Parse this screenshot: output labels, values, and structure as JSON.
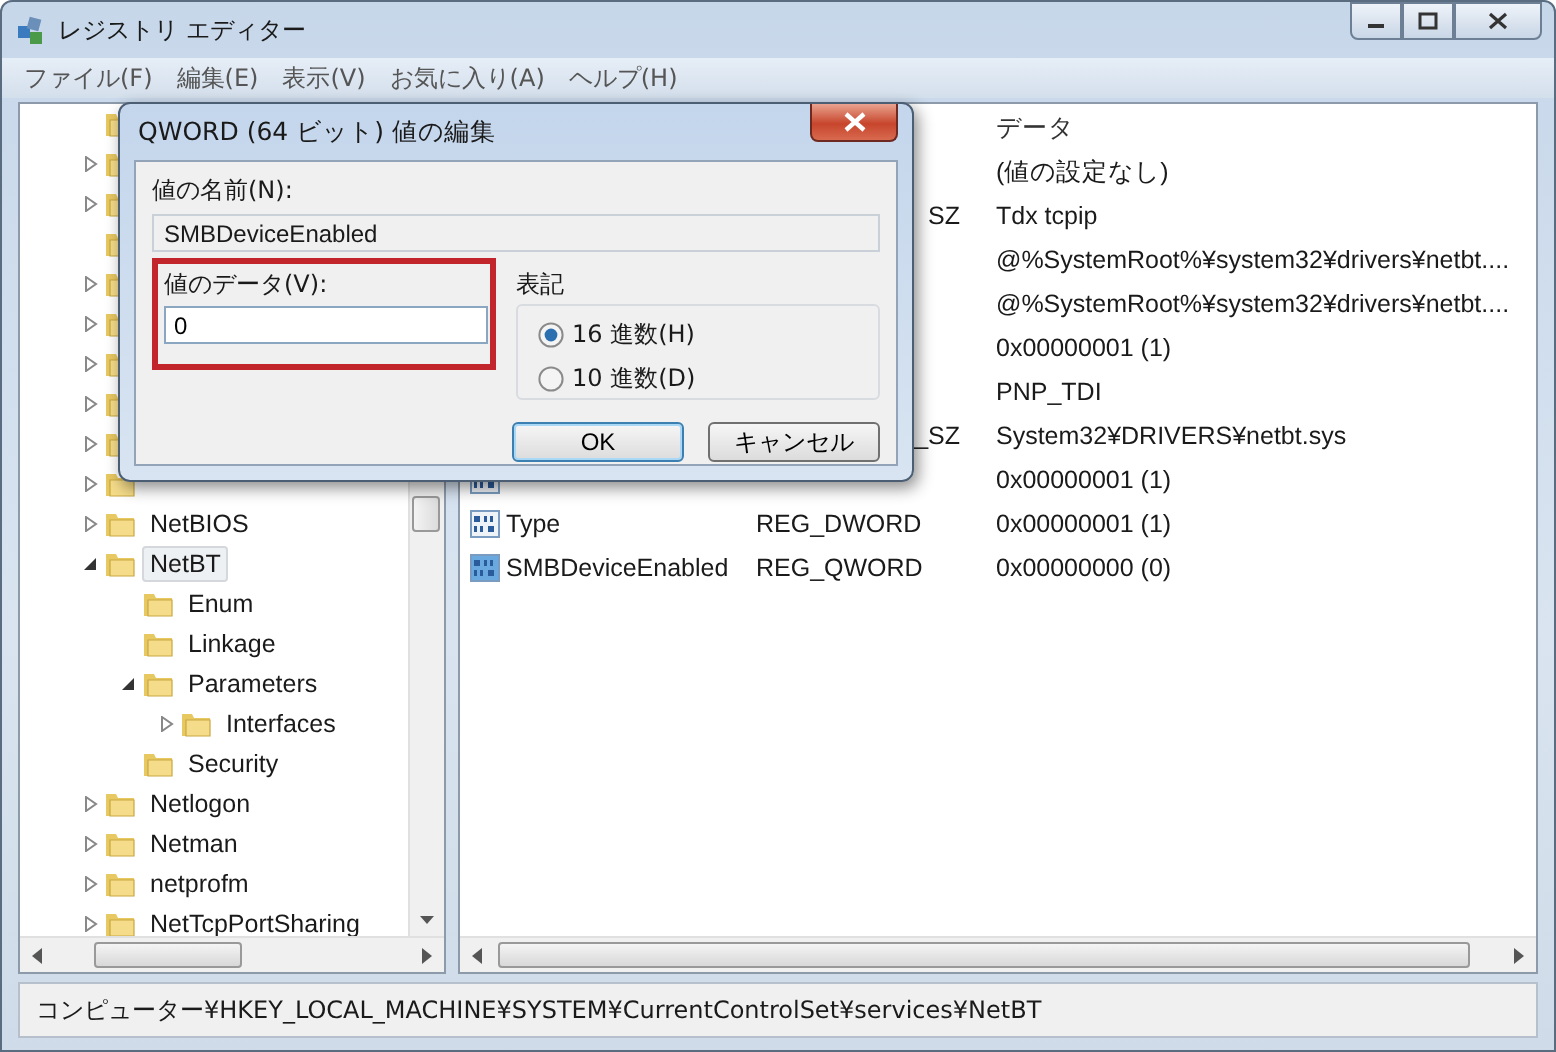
{
  "window": {
    "title": "レジストリ エディター"
  },
  "menu": [
    "ファイル(F)",
    "編集(E)",
    "表示(V)",
    "お気に入り(A)",
    "ヘルプ(H)"
  ],
  "tree": {
    "items": [
      {
        "expandable": false
      },
      {
        "expandable": true,
        "expanded": false
      },
      {
        "expandable": true,
        "expanded": false
      },
      {
        "expandable": false
      },
      {
        "expandable": true,
        "expanded": false
      },
      {
        "expandable": true,
        "expanded": false
      },
      {
        "expandable": true,
        "expanded": false
      },
      {
        "expandable": true,
        "expanded": false
      },
      {
        "expandable": true,
        "expanded": false
      },
      {
        "expandable": true,
        "expanded": false
      },
      {
        "label": "NetBIOS",
        "expandable": true,
        "expanded": false,
        "selected": false
      },
      {
        "label": "NetBT",
        "expandable": true,
        "expanded": true,
        "selected": true,
        "children": [
          {
            "label": "Enum",
            "expandable": false,
            "selected": false
          },
          {
            "label": "Linkage",
            "expandable": false,
            "selected": false
          },
          {
            "label": "Parameters",
            "expandable": true,
            "expanded": true,
            "selected": false,
            "children": [
              {
                "label": "Interfaces",
                "expandable": true,
                "expanded": false,
                "selected": false
              }
            ]
          },
          {
            "label": "Security",
            "expandable": false,
            "selected": false
          }
        ]
      },
      {
        "label": "Netlogon",
        "expandable": true,
        "expanded": false,
        "selected": false
      },
      {
        "label": "Netman",
        "expandable": true,
        "expanded": false,
        "selected": false
      },
      {
        "label": "netprofm",
        "expandable": true,
        "expanded": false,
        "selected": false
      },
      {
        "label": "NetTcpPortSharing",
        "expandable": true,
        "expanded": false,
        "selected": false
      }
    ]
  },
  "list": {
    "columns": [
      {
        "label": "データ"
      }
    ],
    "rows": [
      {
        "data": "(値の設定なし)"
      },
      {
        "type": "SZ",
        "data": "Tdx tcpip"
      },
      {
        "data": "@%SystemRoot%¥system32¥drivers¥netbt...."
      },
      {
        "data": "@%SystemRoot%¥system32¥drivers¥netbt...."
      },
      {
        "data": "0x00000001 (1)"
      },
      {
        "data": "PNP_TDI"
      },
      {
        "type": "_SZ",
        "data": "System32¥DRIVERS¥netbt.sys"
      },
      {
        "kind": "binary",
        "data": "0x00000001 (1)",
        "selected": false
      },
      {
        "kind": "binary",
        "name": "Type",
        "type": "REG_DWORD",
        "data": "0x00000001 (1)",
        "selected": false
      },
      {
        "kind": "binary",
        "name": "SMBDeviceEnabled",
        "type": "REG_QWORD",
        "data": "0x00000000 (0)",
        "selected": true
      }
    ]
  },
  "dialog": {
    "title": "QWORD (64 ビット) 値の編集",
    "name_label": "値の名前(N):",
    "name_value": "SMBDeviceEnabled",
    "data_label": "値のデータ(V):",
    "data_value": "0",
    "data_highlighted": true,
    "base_label": "表記",
    "bases": [
      {
        "label": "16 進数(H)",
        "selected": true
      },
      {
        "label": "10 進数(D)",
        "selected": false
      }
    ],
    "buttons": [
      {
        "label": "OK",
        "default": true
      },
      {
        "label": "キャンセル",
        "default": false
      }
    ]
  },
  "status_bar": "コンピューター¥HKEY_LOCAL_MACHINE¥SYSTEM¥CurrentControlSet¥services¥NetBT"
}
